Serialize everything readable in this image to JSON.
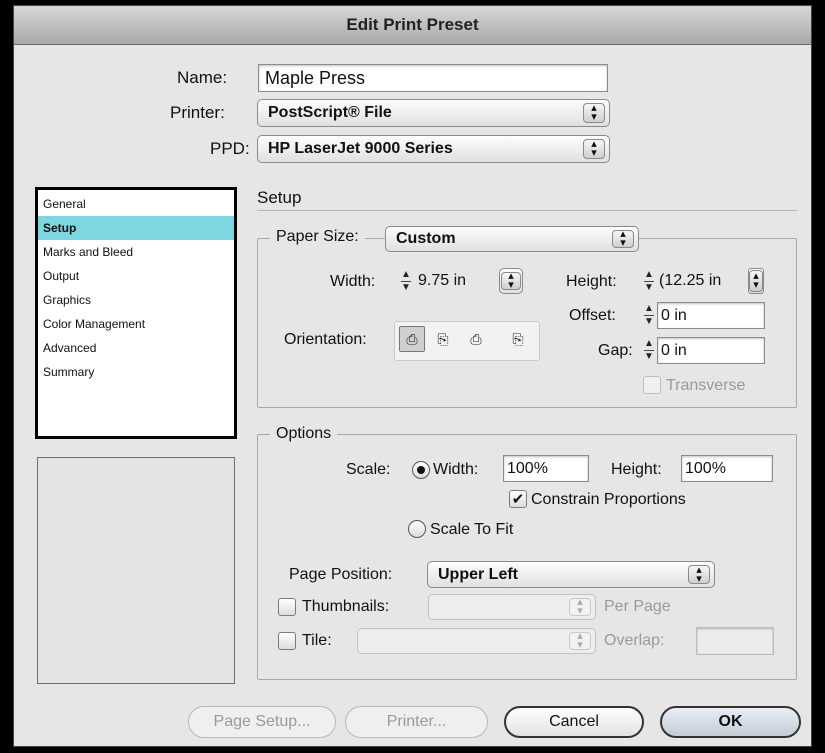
{
  "window": {
    "title": "Edit Print Preset"
  },
  "top": {
    "name_label": "Name:",
    "name_value": "Maple Press",
    "printer_label": "Printer:",
    "printer_value": "PostScript® File",
    "ppd_label": "PPD:",
    "ppd_value": "HP LaserJet 9000 Series"
  },
  "sidebar": {
    "items": [
      {
        "label": "General"
      },
      {
        "label": "Setup"
      },
      {
        "label": "Marks and Bleed"
      },
      {
        "label": "Output"
      },
      {
        "label": "Graphics"
      },
      {
        "label": "Color Management"
      },
      {
        "label": "Advanced"
      },
      {
        "label": "Summary"
      }
    ],
    "selected": "Setup",
    "selected_color": "#7ed6e0"
  },
  "setup": {
    "section_title": "Setup",
    "paper_size_label": "Paper Size:",
    "paper_size_value": "Custom",
    "width_label": "Width:",
    "width_value": "9.75 in",
    "height_label": "Height:",
    "height_value": "(12.25 in",
    "offset_label": "Offset:",
    "offset_value": "0 in",
    "gap_label": "Gap:",
    "gap_value": "0 in",
    "orientation_label": "Orientation:",
    "transverse_label": "Transverse",
    "orientation_icons": [
      "portrait-icon",
      "landscape-icon",
      "reverse-portrait-icon",
      "reverse-landscape-icon"
    ]
  },
  "options": {
    "section_title": "Options",
    "scale_label": "Scale:",
    "scale_width_label": "Width:",
    "scale_width_value": "100%",
    "scale_height_label": "Height:",
    "scale_height_value": "100%",
    "constrain_label": "Constrain Proportions",
    "scale_to_fit_label": "Scale To Fit",
    "page_position_label": "Page Position:",
    "page_position_value": "Upper Left",
    "thumbnails_label": "Thumbnails:",
    "per_page_label": "Per Page",
    "tile_label": "Tile:",
    "overlap_label": "Overlap:"
  },
  "buttons": {
    "page_setup": "Page Setup...",
    "printer": "Printer...",
    "cancel": "Cancel",
    "ok": "OK"
  }
}
